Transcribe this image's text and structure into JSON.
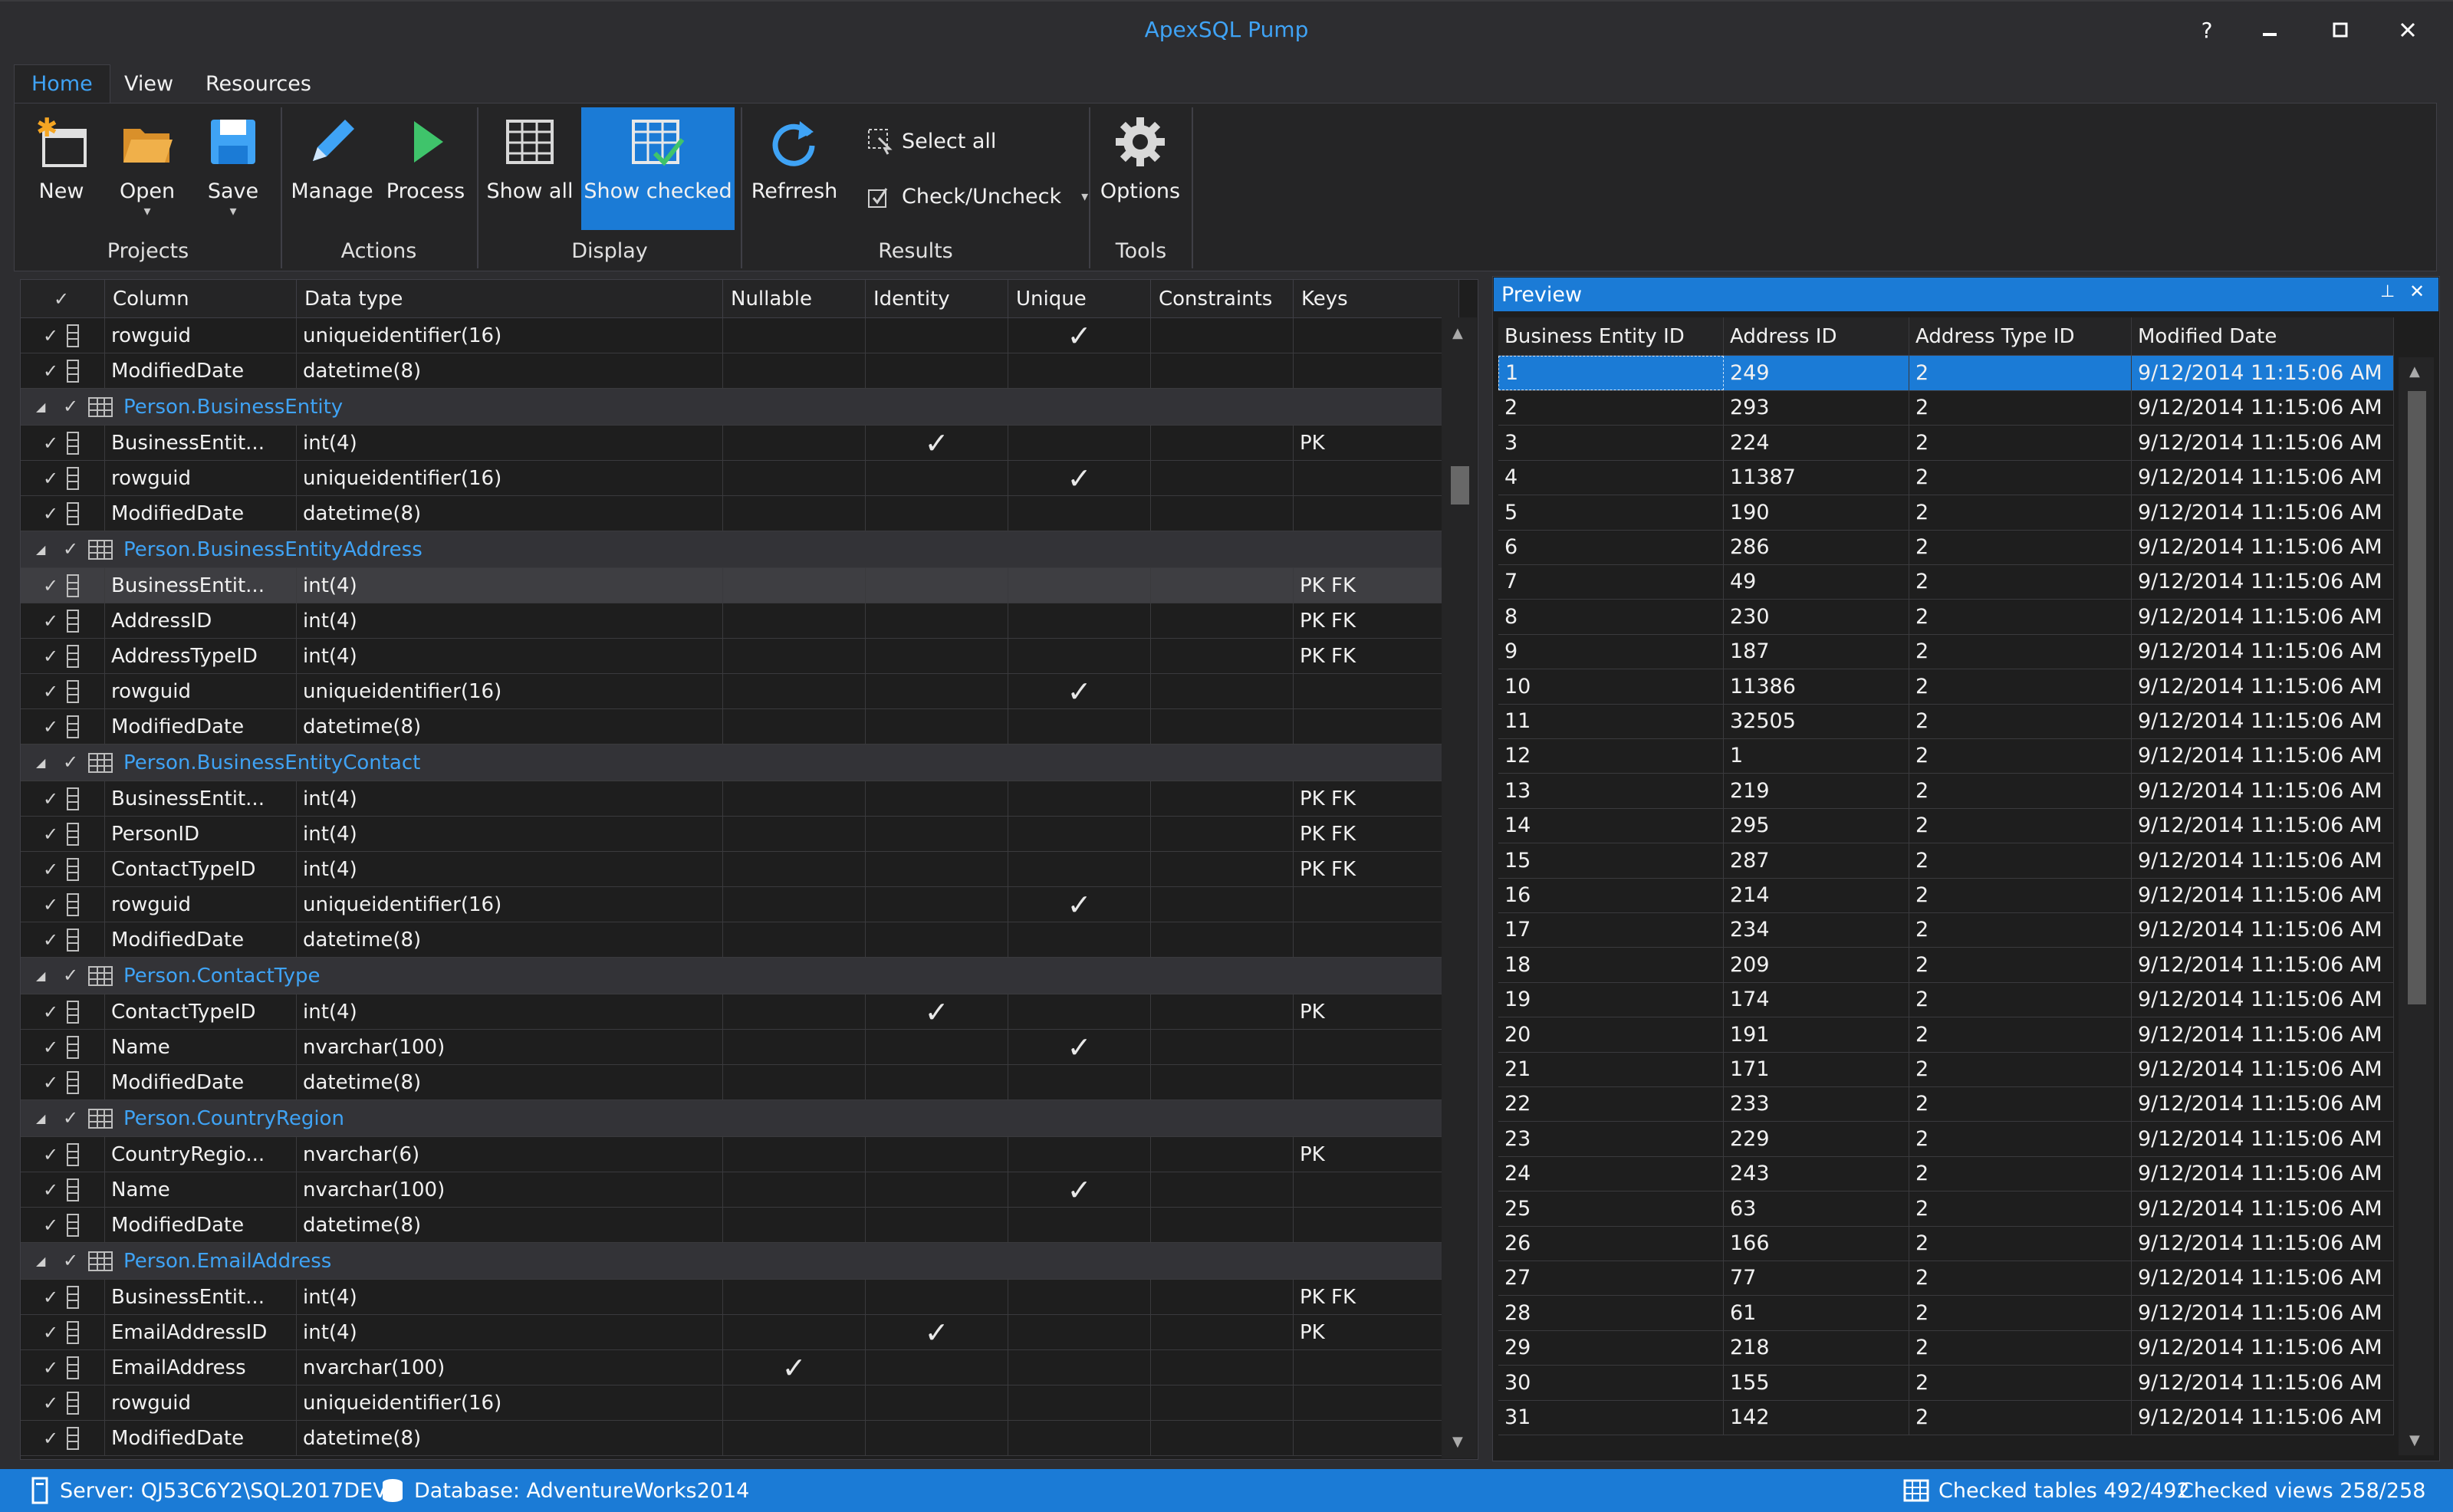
{
  "window": {
    "title": "ApexSQL Pump",
    "help": "?",
    "minimize": "▁",
    "maximize": "☐",
    "close": "✕"
  },
  "menu": {
    "tabs": [
      "Home",
      "View",
      "Resources"
    ]
  },
  "ribbon": {
    "groups": {
      "projects": {
        "label": "Projects",
        "new": "New",
        "open": "Open",
        "save": "Save"
      },
      "actions": {
        "label": "Actions",
        "manage": "Manage",
        "process": "Process"
      },
      "display": {
        "label": "Display",
        "show_all": "Show all",
        "show_checked": "Show checked"
      },
      "results": {
        "label": "Results",
        "refresh": "Refrresh",
        "select_all": "Select all",
        "check_uncheck": "Check/Uncheck"
      },
      "tools": {
        "label": "Tools",
        "options": "Options"
      }
    }
  },
  "grid": {
    "headers": [
      "Column",
      "Data type",
      "Nullable",
      "Identity",
      "Unique",
      "Constraints",
      "Keys"
    ],
    "rows": [
      {
        "kind": "col",
        "name": "rowguid",
        "type": "uniqueidentifier(16)",
        "nullable": false,
        "identity": false,
        "unique": true,
        "keys": ""
      },
      {
        "kind": "col",
        "name": "ModifiedDate",
        "type": "datetime(8)",
        "nullable": false,
        "identity": false,
        "unique": false,
        "keys": ""
      },
      {
        "kind": "group",
        "name": "Person.BusinessEntity"
      },
      {
        "kind": "col",
        "name": "BusinessEntit...",
        "type": "int(4)",
        "nullable": false,
        "identity": true,
        "unique": false,
        "keys": "PK"
      },
      {
        "kind": "col",
        "name": "rowguid",
        "type": "uniqueidentifier(16)",
        "nullable": false,
        "identity": false,
        "unique": true,
        "keys": ""
      },
      {
        "kind": "col",
        "name": "ModifiedDate",
        "type": "datetime(8)",
        "nullable": false,
        "identity": false,
        "unique": false,
        "keys": ""
      },
      {
        "kind": "group",
        "name": "Person.BusinessEntityAddress"
      },
      {
        "kind": "col",
        "name": "BusinessEntit...",
        "type": "int(4)",
        "nullable": false,
        "identity": false,
        "unique": false,
        "keys": "PK FK",
        "selected": true
      },
      {
        "kind": "col",
        "name": "AddressID",
        "type": "int(4)",
        "nullable": false,
        "identity": false,
        "unique": false,
        "keys": "PK FK"
      },
      {
        "kind": "col",
        "name": "AddressTypeID",
        "type": "int(4)",
        "nullable": false,
        "identity": false,
        "unique": false,
        "keys": "PK FK"
      },
      {
        "kind": "col",
        "name": "rowguid",
        "type": "uniqueidentifier(16)",
        "nullable": false,
        "identity": false,
        "unique": true,
        "keys": ""
      },
      {
        "kind": "col",
        "name": "ModifiedDate",
        "type": "datetime(8)",
        "nullable": false,
        "identity": false,
        "unique": false,
        "keys": ""
      },
      {
        "kind": "group",
        "name": "Person.BusinessEntityContact"
      },
      {
        "kind": "col",
        "name": "BusinessEntit...",
        "type": "int(4)",
        "nullable": false,
        "identity": false,
        "unique": false,
        "keys": "PK FK"
      },
      {
        "kind": "col",
        "name": "PersonID",
        "type": "int(4)",
        "nullable": false,
        "identity": false,
        "unique": false,
        "keys": "PK FK"
      },
      {
        "kind": "col",
        "name": "ContactTypeID",
        "type": "int(4)",
        "nullable": false,
        "identity": false,
        "unique": false,
        "keys": "PK FK"
      },
      {
        "kind": "col",
        "name": "rowguid",
        "type": "uniqueidentifier(16)",
        "nullable": false,
        "identity": false,
        "unique": true,
        "keys": ""
      },
      {
        "kind": "col",
        "name": "ModifiedDate",
        "type": "datetime(8)",
        "nullable": false,
        "identity": false,
        "unique": false,
        "keys": ""
      },
      {
        "kind": "group",
        "name": "Person.ContactType"
      },
      {
        "kind": "col",
        "name": "ContactTypeID",
        "type": "int(4)",
        "nullable": false,
        "identity": true,
        "unique": false,
        "keys": "PK"
      },
      {
        "kind": "col",
        "name": "Name",
        "type": "nvarchar(100)",
        "nullable": false,
        "identity": false,
        "unique": true,
        "keys": ""
      },
      {
        "kind": "col",
        "name": "ModifiedDate",
        "type": "datetime(8)",
        "nullable": false,
        "identity": false,
        "unique": false,
        "keys": ""
      },
      {
        "kind": "group",
        "name": "Person.CountryRegion"
      },
      {
        "kind": "col",
        "name": "CountryRegio...",
        "type": "nvarchar(6)",
        "nullable": false,
        "identity": false,
        "unique": false,
        "keys": "PK"
      },
      {
        "kind": "col",
        "name": "Name",
        "type": "nvarchar(100)",
        "nullable": false,
        "identity": false,
        "unique": true,
        "keys": ""
      },
      {
        "kind": "col",
        "name": "ModifiedDate",
        "type": "datetime(8)",
        "nullable": false,
        "identity": false,
        "unique": false,
        "keys": ""
      },
      {
        "kind": "group",
        "name": "Person.EmailAddress"
      },
      {
        "kind": "col",
        "name": "BusinessEntit...",
        "type": "int(4)",
        "nullable": false,
        "identity": false,
        "unique": false,
        "keys": "PK FK"
      },
      {
        "kind": "col",
        "name": "EmailAddressID",
        "type": "int(4)",
        "nullable": false,
        "identity": true,
        "unique": false,
        "keys": "PK"
      },
      {
        "kind": "col",
        "name": "EmailAddress",
        "type": "nvarchar(100)",
        "nullable": true,
        "identity": false,
        "unique": false,
        "keys": ""
      },
      {
        "kind": "col",
        "name": "rowguid",
        "type": "uniqueidentifier(16)",
        "nullable": false,
        "identity": false,
        "unique": false,
        "keys": ""
      },
      {
        "kind": "col",
        "name": "ModifiedDate",
        "type": "datetime(8)",
        "nullable": false,
        "identity": false,
        "unique": false,
        "keys": ""
      }
    ]
  },
  "preview": {
    "title": "Preview",
    "pin": "⊥",
    "close": "✕",
    "headers": [
      "Business Entity ID",
      "Address ID",
      "Address Type ID",
      "Modified Date"
    ],
    "rows": [
      [
        "1",
        "249",
        "2",
        "9/12/2014 11:15:06 AM"
      ],
      [
        "2",
        "293",
        "2",
        "9/12/2014 11:15:06 AM"
      ],
      [
        "3",
        "224",
        "2",
        "9/12/2014 11:15:06 AM"
      ],
      [
        "4",
        "11387",
        "2",
        "9/12/2014 11:15:06 AM"
      ],
      [
        "5",
        "190",
        "2",
        "9/12/2014 11:15:06 AM"
      ],
      [
        "6",
        "286",
        "2",
        "9/12/2014 11:15:06 AM"
      ],
      [
        "7",
        "49",
        "2",
        "9/12/2014 11:15:06 AM"
      ],
      [
        "8",
        "230",
        "2",
        "9/12/2014 11:15:06 AM"
      ],
      [
        "9",
        "187",
        "2",
        "9/12/2014 11:15:06 AM"
      ],
      [
        "10",
        "11386",
        "2",
        "9/12/2014 11:15:06 AM"
      ],
      [
        "11",
        "32505",
        "2",
        "9/12/2014 11:15:06 AM"
      ],
      [
        "12",
        "1",
        "2",
        "9/12/2014 11:15:06 AM"
      ],
      [
        "13",
        "219",
        "2",
        "9/12/2014 11:15:06 AM"
      ],
      [
        "14",
        "295",
        "2",
        "9/12/2014 11:15:06 AM"
      ],
      [
        "15",
        "287",
        "2",
        "9/12/2014 11:15:06 AM"
      ],
      [
        "16",
        "214",
        "2",
        "9/12/2014 11:15:06 AM"
      ],
      [
        "17",
        "234",
        "2",
        "9/12/2014 11:15:06 AM"
      ],
      [
        "18",
        "209",
        "2",
        "9/12/2014 11:15:06 AM"
      ],
      [
        "19",
        "174",
        "2",
        "9/12/2014 11:15:06 AM"
      ],
      [
        "20",
        "191",
        "2",
        "9/12/2014 11:15:06 AM"
      ],
      [
        "21",
        "171",
        "2",
        "9/12/2014 11:15:06 AM"
      ],
      [
        "22",
        "233",
        "2",
        "9/12/2014 11:15:06 AM"
      ],
      [
        "23",
        "229",
        "2",
        "9/12/2014 11:15:06 AM"
      ],
      [
        "24",
        "243",
        "2",
        "9/12/2014 11:15:06 AM"
      ],
      [
        "25",
        "63",
        "2",
        "9/12/2014 11:15:06 AM"
      ],
      [
        "26",
        "166",
        "2",
        "9/12/2014 11:15:06 AM"
      ],
      [
        "27",
        "77",
        "2",
        "9/12/2014 11:15:06 AM"
      ],
      [
        "28",
        "61",
        "2",
        "9/12/2014 11:15:06 AM"
      ],
      [
        "29",
        "218",
        "2",
        "9/12/2014 11:15:06 AM"
      ],
      [
        "30",
        "155",
        "2",
        "9/12/2014 11:15:06 AM"
      ],
      [
        "31",
        "142",
        "2",
        "9/12/2014 11:15:06 AM"
      ]
    ]
  },
  "statusbar": {
    "server": "Server: QJ53C6Y2\\SQL2017DEV",
    "database": "Database: AdventureWorks2014",
    "checked_tables": "Checked tables 492/492",
    "checked_views": "Checked views 258/258"
  },
  "colors": {
    "accent": "#1b7bd6",
    "link": "#3fa3f5",
    "background": "#2d2d30"
  },
  "icons": [
    "new-project-icon",
    "open-folder-icon",
    "save-disk-icon",
    "manage-pencil-icon",
    "process-play-icon",
    "show-all-grid-icon",
    "show-checked-grid-icon",
    "refresh-icon",
    "select-all-icon",
    "check-uncheck-icon",
    "options-gear-icon",
    "server-icon",
    "database-icon",
    "table-icon"
  ]
}
